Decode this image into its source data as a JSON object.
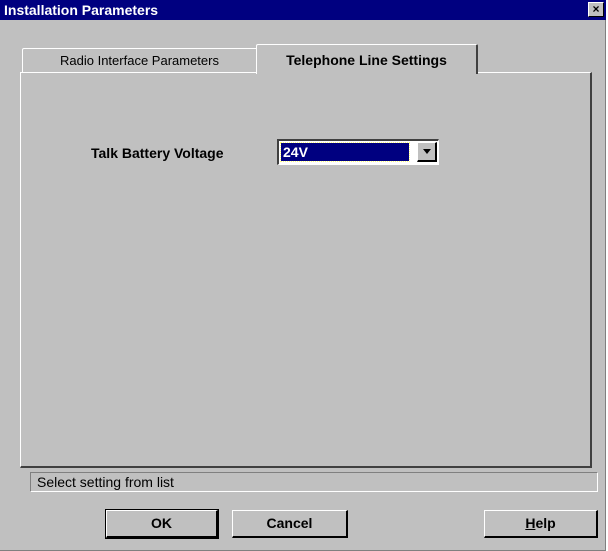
{
  "window": {
    "title": "Installation Parameters",
    "close_label": "×"
  },
  "tabs": [
    {
      "label": "Radio Interface Parameters",
      "active": false
    },
    {
      "label": "Telephone Line Settings",
      "active": true
    }
  ],
  "settings": {
    "talk_battery_label": "Talk Battery Voltage",
    "talk_battery_value": "24V"
  },
  "status": {
    "text": "Select setting from list"
  },
  "buttons": {
    "ok": "OK",
    "cancel": "Cancel",
    "help_mnemonic": "H",
    "help_rest": "elp"
  },
  "colors": {
    "titlebar": "#000080",
    "dialog_bg": "#c0c0c0",
    "selection": "#000080"
  }
}
